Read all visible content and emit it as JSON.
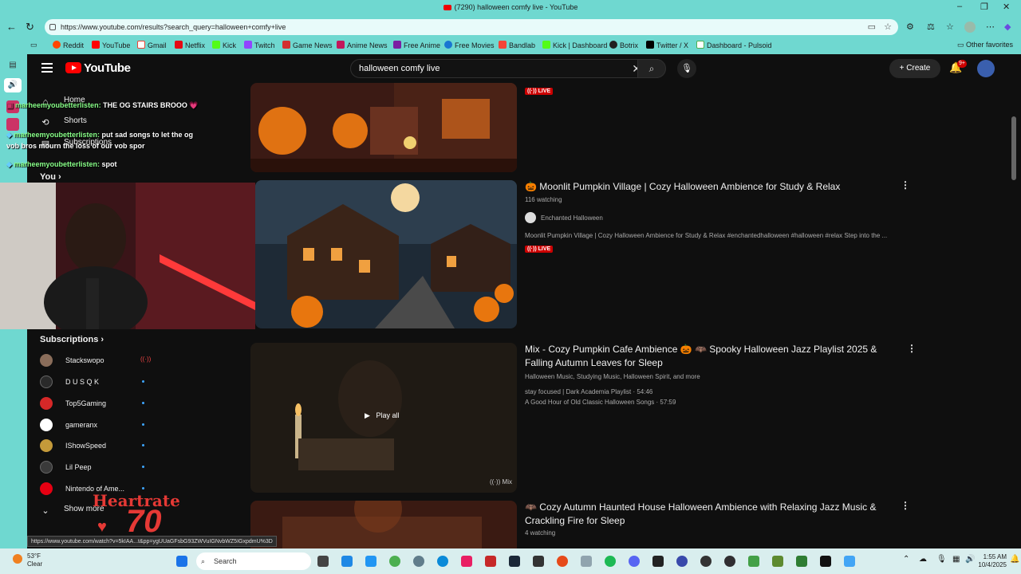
{
  "browser": {
    "window_title": "(7290) halloween comfy live - YouTube",
    "url": "https://www.youtube.com/results?search_query=halloween+comfy+live",
    "bookmarks": [
      {
        "label": "Reddit",
        "color": "#ff4500"
      },
      {
        "label": "YouTube",
        "color": "#ff0000"
      },
      {
        "label": "Gmail",
        "color": "#ea4335"
      },
      {
        "label": "Netflix",
        "color": "#e50914"
      },
      {
        "label": "Kick",
        "color": "#53fc18"
      },
      {
        "label": "Twitch",
        "color": "#9146ff"
      },
      {
        "label": "Game News",
        "color": "#d32f2f"
      },
      {
        "label": "Anime News",
        "color": "#c2185b"
      },
      {
        "label": "Free Anime",
        "color": "#7b1fa2"
      },
      {
        "label": "Free Movies",
        "color": "#1976d2"
      },
      {
        "label": "Bandlab",
        "color": "#f44336"
      },
      {
        "label": "Kick | Dashboard",
        "color": "#53fc18"
      },
      {
        "label": "Botrix",
        "color": "#212121"
      },
      {
        "label": "Twitter / X",
        "color": "#000000"
      },
      {
        "label": "Dashboard - Pulsoid",
        "color": "#4caf50"
      }
    ],
    "other_favorites": "Other favorites"
  },
  "youtube": {
    "logo": "YouTube",
    "search_value": "halloween comfy live",
    "create_label": "Create",
    "notif_count": "9+",
    "sidebar": {
      "home": "Home",
      "shorts": "Shorts",
      "subscriptions_link": "Subscriptions",
      "you": "You",
      "subscriptions_heading": "Subscriptions",
      "channels": [
        {
          "name": "Stackswopo",
          "color": "#8a6d5a",
          "live": true
        },
        {
          "name": "D U S Q K",
          "color": "#2a2a2a",
          "live": false
        },
        {
          "name": "Top5Gaming",
          "color": "#d62828",
          "live": false
        },
        {
          "name": "gameranx",
          "color": "#ffffff",
          "live": false
        },
        {
          "name": "IShowSpeed",
          "color": "#c49a3a",
          "live": false
        },
        {
          "name": "Lil Peep",
          "color": "#3a3a3a",
          "live": false
        },
        {
          "name": "Nintendo of Ame...",
          "color": "#e60012",
          "live": false
        }
      ],
      "show_more": "Show more"
    },
    "results": [
      {
        "title": "",
        "live_label": "LIVE"
      },
      {
        "title": "🎃 Moonlit Pumpkin Village | Cozy Halloween Ambience for Study & Relax",
        "watching": "116 watching",
        "channel": "Enchanted Halloween",
        "description": "Moonlit Pumpkin Village | Cozy Halloween Ambience for Study & Relax #enchantedhalloween #halloween #relax Step into the ...",
        "live_label": "LIVE"
      },
      {
        "title": "Mix - Cozy Pumpkin Cafe Ambience 🎃 🦇 Spooky Halloween Jazz Playlist 2025 & Falling Autumn Leaves for Sleep",
        "subtitle": "Halloween Music, Studying Music, Halloween Spirit, and more",
        "track1": "stay focused | Dark Academia Playlist · 54:46",
        "track2": "A Good Hour of Old Classic Halloween Songs · 57:59",
        "play_all": "Play all",
        "mix_label": "Mix"
      },
      {
        "title": "🦇 Cozy Autumn Haunted House Halloween Ambience with Relaxing Jazz Music & Crackling Fire for Sleep",
        "watching": "4 watching"
      }
    ]
  },
  "overlay": {
    "chat": [
      {
        "user": "marheemyoubetterlisten:",
        "text": "THE OG STAIRS BROOO 💗"
      },
      {
        "user": "marheemyoubetterlisten:",
        "text": "put sad songs to let the og",
        "text2": "vob bros mourn the loss of our vob spor"
      },
      {
        "user": "marheemyoubetterlisten:",
        "text": "spot"
      }
    ],
    "heartrate_label": "Heartrate",
    "heartrate_value": "70",
    "status_url": "https://www.youtube.com/watch?v=5kIAA...t&pp=ygUUaGFsbG93ZWVuIGNvbWZ5IGxpdmU%3D"
  },
  "taskbar": {
    "weather_temp": "53°F",
    "weather_desc": "Clear",
    "search_placeholder": "Search",
    "time": "1:55 AM",
    "date": "10/4/2025"
  }
}
